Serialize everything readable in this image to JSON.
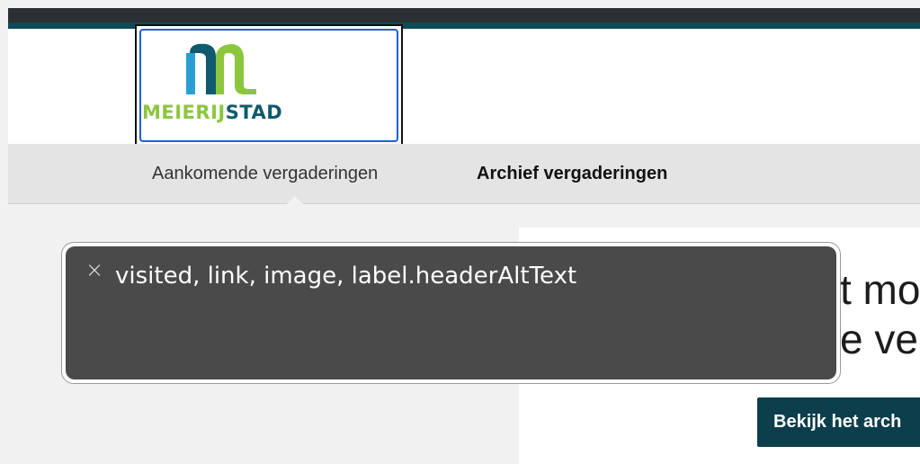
{
  "header": {
    "logo_text_green": "MEIERIJ",
    "logo_text_teal": "STAD"
  },
  "nav": {
    "items": [
      {
        "label": "Aankomende vergaderingen",
        "active": true
      },
      {
        "label": "Archief vergaderingen",
        "active": false
      }
    ]
  },
  "content": {
    "hero_line1": "t mo",
    "hero_line2": "e ver",
    "archive_button_label": "Bekijk het arch"
  },
  "voiceover": {
    "close_icon": "close-icon",
    "text": "visited, link, image, label.headerAltText"
  },
  "colors": {
    "top_bar": "#2c2f33",
    "teal": "#0d4a57",
    "logo_green": "#8cc63f",
    "logo_blue": "#2a9fd6",
    "button_bg": "#0c3e4b",
    "focus_ring": "#1e5fd6"
  }
}
